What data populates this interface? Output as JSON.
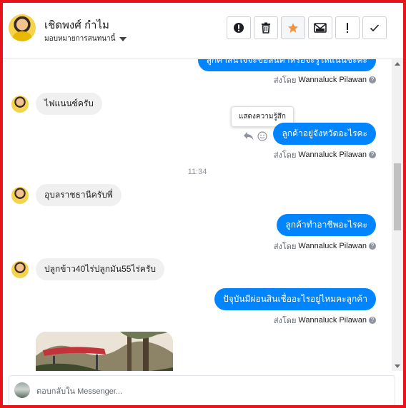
{
  "header": {
    "contact_name": "เชิดพงศ์ กำไม",
    "assign_label": "มอบหมายการสนทนานี้",
    "tools": [
      {
        "name": "report-icon",
        "label": "Report"
      },
      {
        "name": "trash-icon",
        "label": "Delete"
      },
      {
        "name": "star-icon",
        "label": "Star"
      },
      {
        "name": "mail-icon",
        "label": "Mark as unread"
      },
      {
        "name": "exclamation-icon",
        "label": "Spam"
      },
      {
        "name": "check-icon",
        "label": "Done"
      }
    ]
  },
  "messages": {
    "m1_out": "ลูกค้าสนใจจะขอสินค้าหรือจะรู้ให้แนนชะคะ",
    "m1_sent_prefix": "ส่งโดย",
    "m1_sender": "Wannaluck Pilawan",
    "m2_in": "ไฟแนนซ์ครับ",
    "tooltip": "แสดงความรู้สึก",
    "m3_out": "ลูกค้าอยู่จังหวัดอะไรคะ",
    "m3_sent_prefix": "ส่งโดย",
    "m3_sender": "Wannaluck Pilawan",
    "time": "11:34",
    "m4_in": "อุบลราชธานีครับพี่",
    "m5_out": "ลูกค้าทำอาชีพอะไรคะ",
    "m5_sent_prefix": "ส่งโดย",
    "m5_sender": "Wannaluck Pilawan",
    "m6_in": "ปลูกข้าว40ไร่ปลูกมัน55ไร่ครับ",
    "m7_out": "ปัจุบันมีผ่อนสินเชื่ออะไรอยู่ไหมคะลูกค้า",
    "m7_sent_prefix": "ส่งโดย",
    "m7_sender": "Wannaluck Pilawan"
  },
  "composer": {
    "placeholder": "ตอบกลับใน Messenger..."
  },
  "colors": {
    "frame": "#e8141c",
    "outgoing_bubble": "#0084ff",
    "incoming_bubble": "#f0f0f0",
    "star": "#f7923a"
  }
}
